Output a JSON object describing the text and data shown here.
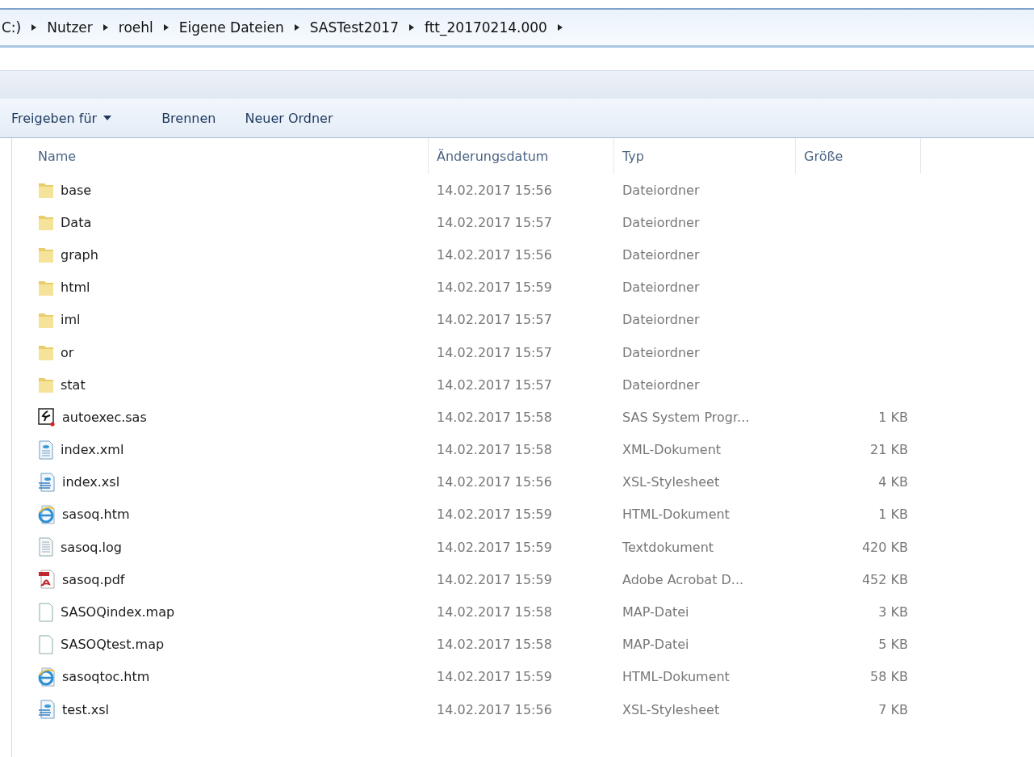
{
  "breadcrumb": [
    "C:)",
    "Nutzer",
    "roehl",
    "Eigene Dateien",
    "SASTest2017",
    "ftt_20170214.000"
  ],
  "toolbar": [
    {
      "label": "Freigeben für",
      "dropdown": true
    },
    {
      "label": "Brennen",
      "dropdown": false
    },
    {
      "label": "Neuer Ordner",
      "dropdown": false
    }
  ],
  "columns": [
    "Name",
    "Änderungsdatum",
    "Typ",
    "Größe"
  ],
  "rows": [
    {
      "kind": "folder",
      "name": "base",
      "date": "14.02.2017 15:56",
      "type": "Dateiordner"
    },
    {
      "kind": "folder",
      "name": "Data",
      "date": "14.02.2017 15:57",
      "type": "Dateiordner"
    },
    {
      "kind": "folder",
      "name": "graph",
      "date": "14.02.2017 15:56",
      "type": "Dateiordner"
    },
    {
      "kind": "folder",
      "name": "html",
      "date": "14.02.2017 15:59",
      "type": "Dateiordner"
    },
    {
      "kind": "folder",
      "name": "iml",
      "date": "14.02.2017 15:57",
      "type": "Dateiordner"
    },
    {
      "kind": "folder",
      "name": "or",
      "date": "14.02.2017 15:57",
      "type": "Dateiordner"
    },
    {
      "kind": "folder",
      "name": "stat",
      "date": "14.02.2017 15:57",
      "type": "Dateiordner"
    },
    {
      "kind": "sas",
      "name": "autoexec.sas",
      "date": "14.02.2017 15:58",
      "type": "SAS System Progr...",
      "size": "1 KB"
    },
    {
      "kind": "xml",
      "name": "index.xml",
      "date": "14.02.2017 15:58",
      "type": "XML-Dokument",
      "size": "21 KB"
    },
    {
      "kind": "xsl",
      "name": "index.xsl",
      "date": "14.02.2017 15:56",
      "type": "XSL-Stylesheet",
      "size": "4 KB"
    },
    {
      "kind": "htm",
      "name": "sasoq.htm",
      "date": "14.02.2017 15:59",
      "type": "HTML-Dokument",
      "size": "1 KB"
    },
    {
      "kind": "text",
      "name": "sasoq.log",
      "date": "14.02.2017 15:59",
      "type": "Textdokument",
      "size": "420 KB"
    },
    {
      "kind": "pdf",
      "name": "sasoq.pdf",
      "date": "14.02.2017 15:59",
      "type": "Adobe Acrobat D...",
      "size": "452 KB"
    },
    {
      "kind": "blank",
      "name": "SASOQindex.map",
      "date": "14.02.2017 15:58",
      "type": "MAP-Datei",
      "size": "3 KB"
    },
    {
      "kind": "blank",
      "name": "SASOQtest.map",
      "date": "14.02.2017 15:58",
      "type": "MAP-Datei",
      "size": "5 KB"
    },
    {
      "kind": "htm",
      "name": "sasoqtoc.htm",
      "date": "14.02.2017 15:59",
      "type": "HTML-Dokument",
      "size": "58 KB"
    },
    {
      "kind": "xsl",
      "name": "test.xsl",
      "date": "14.02.2017 15:56",
      "type": "XSL-Stylesheet",
      "size": "7 KB"
    }
  ]
}
